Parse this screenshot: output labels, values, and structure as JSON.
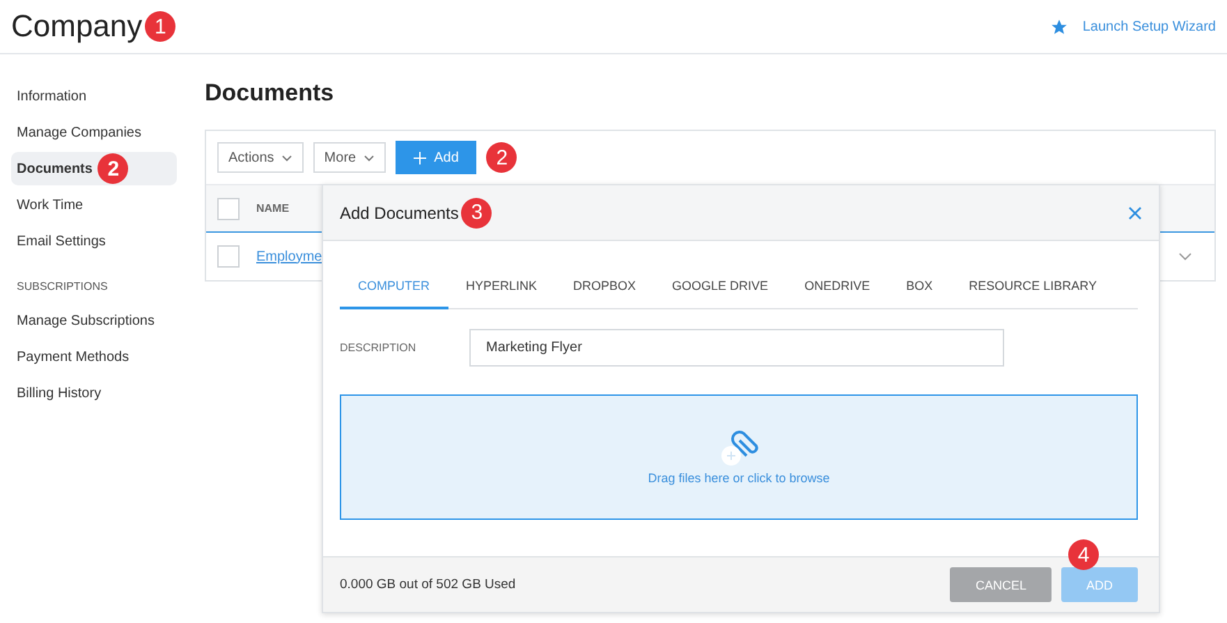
{
  "header": {
    "title": "Company",
    "title_callout": "1",
    "wizard_link": "Launch Setup Wizard"
  },
  "sidebar": {
    "groups": [
      {
        "items": [
          {
            "label": "Information",
            "selected": false
          },
          {
            "label": "Manage Companies",
            "selected": false
          },
          {
            "label": "Documents",
            "selected": true,
            "callout": "2"
          },
          {
            "label": "Work Time",
            "selected": false
          },
          {
            "label": "Email Settings",
            "selected": false
          }
        ]
      },
      {
        "heading": "SUBSCRIPTIONS",
        "items": [
          {
            "label": "Manage Subscriptions",
            "selected": false
          },
          {
            "label": "Payment Methods",
            "selected": false
          },
          {
            "label": "Billing History",
            "selected": false
          }
        ]
      }
    ]
  },
  "main": {
    "title": "Documents",
    "toolbar": {
      "actions": "Actions",
      "more": "More",
      "add": "Add",
      "add_callout": "2"
    },
    "table": {
      "header_checked": false,
      "columns": [
        "NAME"
      ],
      "rows": [
        {
          "name": "Employme",
          "checked": false
        }
      ]
    }
  },
  "modal": {
    "title": "Add Documents",
    "title_callout": "3",
    "tabs": [
      {
        "label": "COMPUTER",
        "selected": true
      },
      {
        "label": "HYPERLINK",
        "selected": false
      },
      {
        "label": "DROPBOX",
        "selected": false
      },
      {
        "label": "GOOGLE DRIVE",
        "selected": false
      },
      {
        "label": "ONEDRIVE",
        "selected": false
      },
      {
        "label": "BOX",
        "selected": false
      },
      {
        "label": "RESOURCE LIBRARY",
        "selected": false
      }
    ],
    "description": {
      "label": "DESCRIPTION",
      "value": "Marketing Flyer"
    },
    "dropzone": {
      "text": "Drag files here or click to browse"
    },
    "usage": "0.000 GB out of 502 GB Used",
    "buttons": [
      {
        "label": "CANCEL",
        "kind": "cancel",
        "disabled": false
      },
      {
        "label": "ADD",
        "kind": "primary",
        "disabled": true,
        "callout": "4"
      }
    ]
  }
}
